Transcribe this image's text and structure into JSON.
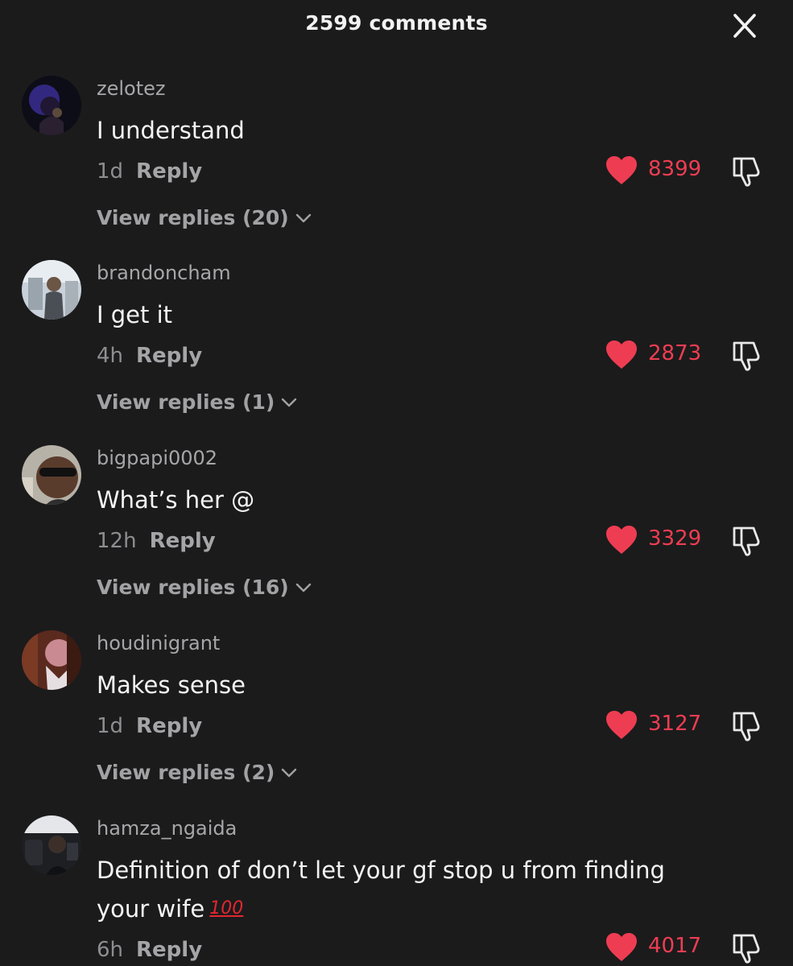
{
  "header": {
    "title": "2599 comments"
  },
  "icons": {
    "close": "close-icon",
    "like": "heart-icon",
    "dislike": "thumbs-down-icon",
    "expand": "chevron-down-icon"
  },
  "colors": {
    "background": "#1b1b1c",
    "like": "#ee3d52",
    "secondary_text": "#a7a7a9"
  },
  "comments": [
    {
      "username": "zelotez",
      "text": "I understand",
      "time": "1d",
      "reply_label": "Reply",
      "likes": "8399",
      "view_replies": "View replies (20)"
    },
    {
      "username": "brandoncham",
      "text": "I get it",
      "time": "4h",
      "reply_label": "Reply",
      "likes": "2873",
      "view_replies": "View replies (1)"
    },
    {
      "username": "bigpapi0002",
      "text": "What’s her @",
      "time": "12h",
      "reply_label": "Reply",
      "likes": "3329",
      "view_replies": "View replies (16)"
    },
    {
      "username": "houdinigrant",
      "text": "Makes sense",
      "time": "1d",
      "reply_label": "Reply",
      "likes": "3127",
      "view_replies": "View replies (2)"
    },
    {
      "username": "hamza_ngaida",
      "text": "Definition of don’t let your gf stop u from finding your wife",
      "emoji": "100",
      "time": "6h",
      "reply_label": "Reply",
      "likes": "4017"
    }
  ]
}
